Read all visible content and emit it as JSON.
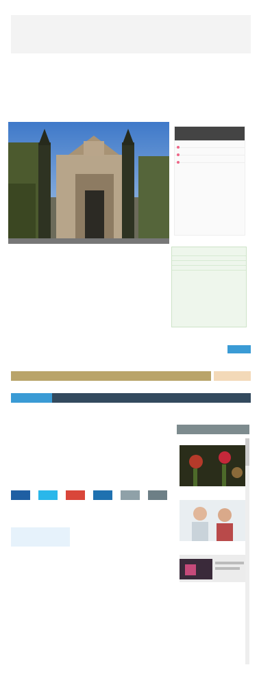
{
  "topbar": {
    "left_link": "",
    "center_links": [
      "",
      ""
    ],
    "right_links": [
      "",
      ""
    ]
  },
  "article1": {
    "section": "",
    "headline": "",
    "caption": "",
    "byline": "",
    "paragraphs": [
      "",
      "",
      ""
    ]
  },
  "sidebar1": {
    "header": "",
    "items": [
      "",
      "",
      ""
    ]
  },
  "promo": {
    "title": "",
    "rows": [
      "",
      "",
      "",
      ""
    ]
  },
  "site2": {
    "nav_links": [
      "",
      "",
      "",
      "",
      "",
      ""
    ],
    "subscribe_button": "",
    "brand_main": "",
    "brand_accent": "",
    "brand_sub": "",
    "gold_bar": "",
    "gold_tag": ""
  },
  "bluenav": {
    "active": "",
    "rest": ""
  },
  "article2": {
    "headline": "",
    "date": "",
    "tags_label": "",
    "tags": "",
    "quote_title": "",
    "quote_body": "",
    "paragraphs": [
      "",
      "",
      ""
    ],
    "highlight": "",
    "subhead": "",
    "paragraphs2": [
      ""
    ]
  },
  "sidebar2": {
    "header": "",
    "items": [
      "",
      "",
      "",
      ""
    ]
  },
  "colors": {
    "share": [
      "#1f5fa3",
      "#2ab7ea",
      "#d9463a",
      "#1f71b0",
      "#8fa1a8",
      "#6d7f86"
    ]
  }
}
